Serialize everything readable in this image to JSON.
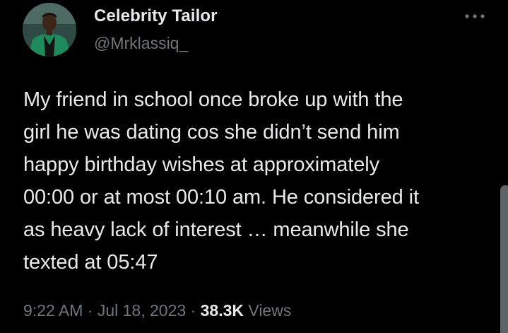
{
  "author": {
    "display_name": "Celebrity Tailor",
    "handle": "@Mrklassiq_",
    "avatar": "profile-photo"
  },
  "tweet": {
    "text": "My friend in school once broke up with the\ngirl he was dating cos she didn’t send him\nhappy birthday wishes at approximately\n00:00 or at most 00:10 am. He considered it\nas heavy lack of interest … meanwhile she\ntexted at 05:47",
    "time": "9:22 AM",
    "separator": "·",
    "date": "Jul 18, 2023",
    "views_count": "38.3K",
    "views_label": "Views"
  },
  "icons": {
    "more": "more-horizontal-icon"
  },
  "colors": {
    "background": "#000000",
    "primary_text": "#e7e9ea",
    "secondary_text": "#71767b"
  }
}
